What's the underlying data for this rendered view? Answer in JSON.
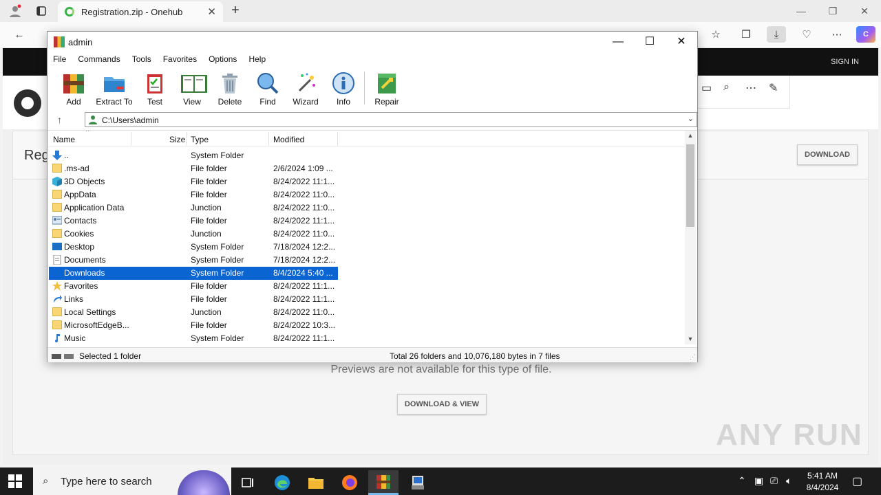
{
  "browser": {
    "tab_title": "Registration.zip - Onehub",
    "tab_close": "✕",
    "new_tab": "+",
    "window_controls": {
      "minimize": "—",
      "restore": "❐",
      "close": "✕"
    }
  },
  "page": {
    "sign_in": "SIGN IN",
    "card_title": "Reg",
    "download_button": "DOWNLOAD",
    "preview_message": "Previews are not available for this type of file.",
    "download_view_button": "DOWNLOAD & VIEW",
    "watermark": "ANY RUN"
  },
  "winrar": {
    "title": "admin",
    "menu": [
      "File",
      "Commands",
      "Tools",
      "Favorites",
      "Options",
      "Help"
    ],
    "toolbar": [
      {
        "label": "Add",
        "icon": "add-archive-icon"
      },
      {
        "label": "Extract To",
        "icon": "extract-folder-icon"
      },
      {
        "label": "Test",
        "icon": "test-clipboard-icon"
      },
      {
        "label": "View",
        "icon": "view-book-icon"
      },
      {
        "label": "Delete",
        "icon": "trash-icon"
      },
      {
        "label": "Find",
        "icon": "magnifier-icon"
      },
      {
        "label": "Wizard",
        "icon": "wizard-wand-icon"
      },
      {
        "label": "Info",
        "icon": "info-icon"
      },
      {
        "label": "Repair",
        "icon": "repair-icon"
      }
    ],
    "address": "C:\\Users\\admin",
    "columns": {
      "name": "Name",
      "size": "Size",
      "type": "Type",
      "modified": "Modified"
    },
    "files": [
      {
        "name": "..",
        "size": "",
        "type": "System Folder",
        "modified": "",
        "icon": "up-arrow-icon"
      },
      {
        "name": ".ms-ad",
        "size": "",
        "type": "File folder",
        "modified": "2/6/2024 1:09 ...",
        "icon": "folder-icon"
      },
      {
        "name": "3D Objects",
        "size": "",
        "type": "File folder",
        "modified": "8/24/2022 11:1...",
        "icon": "3d-objects-icon"
      },
      {
        "name": "AppData",
        "size": "",
        "type": "File folder",
        "modified": "8/24/2022 11:0...",
        "icon": "folder-icon"
      },
      {
        "name": "Application Data",
        "size": "",
        "type": "Junction",
        "modified": "8/24/2022 11:0...",
        "icon": "folder-icon"
      },
      {
        "name": "Contacts",
        "size": "",
        "type": "File folder",
        "modified": "8/24/2022 11:1...",
        "icon": "contacts-icon"
      },
      {
        "name": "Cookies",
        "size": "",
        "type": "Junction",
        "modified": "8/24/2022 11:0...",
        "icon": "folder-icon"
      },
      {
        "name": "Desktop",
        "size": "",
        "type": "System Folder",
        "modified": "7/18/2024 12:2...",
        "icon": "desktop-icon"
      },
      {
        "name": "Documents",
        "size": "",
        "type": "System Folder",
        "modified": "7/18/2024 12:2...",
        "icon": "documents-icon"
      },
      {
        "name": "Downloads",
        "size": "",
        "type": "System Folder",
        "modified": "8/4/2024 5:40 ...",
        "icon": "downloads-icon"
      },
      {
        "name": "Favorites",
        "size": "",
        "type": "File folder",
        "modified": "8/24/2022 11:1...",
        "icon": "star-icon"
      },
      {
        "name": "Links",
        "size": "",
        "type": "File folder",
        "modified": "8/24/2022 11:1...",
        "icon": "links-icon"
      },
      {
        "name": "Local Settings",
        "size": "",
        "type": "Junction",
        "modified": "8/24/2022 11:0...",
        "icon": "folder-icon"
      },
      {
        "name": "MicrosoftEdgeB...",
        "size": "",
        "type": "File folder",
        "modified": "8/24/2022 10:3...",
        "icon": "folder-icon"
      },
      {
        "name": "Music",
        "size": "",
        "type": "System Folder",
        "modified": "8/24/2022 11:1...",
        "icon": "music-icon"
      }
    ],
    "selected_row": 9,
    "status_left": "Selected 1 folder",
    "status_right": "Total 26 folders and 10,076,180 bytes in 7 files"
  },
  "taskbar": {
    "search_placeholder": "Type here to search",
    "time": "5:41 AM",
    "date": "8/4/2024"
  },
  "colors": {
    "selection": "#0a64d2",
    "taskbar": "#1c1c1c",
    "folder": "#f7d673"
  }
}
